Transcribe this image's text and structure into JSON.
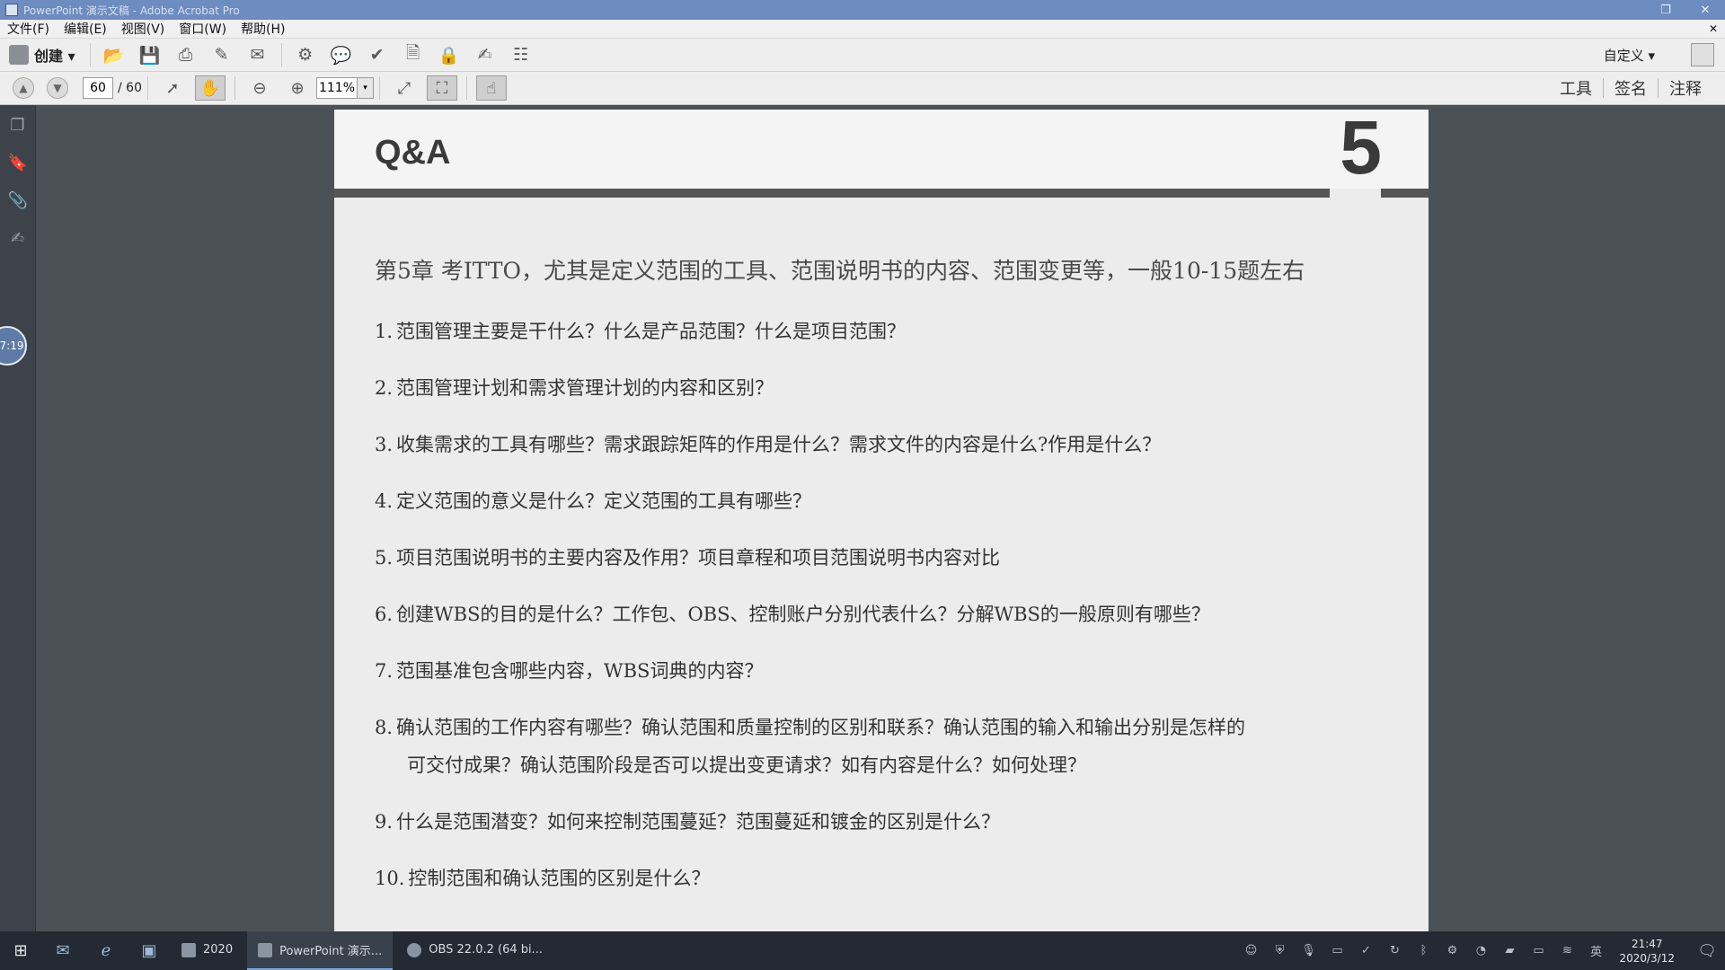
{
  "window": {
    "title": "PowerPoint 演示文稿 - Adobe Acrobat Pro",
    "restore_icon": "restore-icon",
    "close_icon": "close-icon",
    "restore_glyph": "❐",
    "close_glyph": "✕"
  },
  "menu": {
    "items": [
      "文件(F)",
      "编辑(E)",
      "视图(V)",
      "窗口(W)",
      "帮助(H)"
    ],
    "close_glyph": "✕"
  },
  "toolbar": {
    "create_label": "创建 ▾",
    "custom_label": "自定义 ▾"
  },
  "nav": {
    "current_page": "60",
    "total_pages": "/ 60",
    "zoom": "111%",
    "zoom_arrow": "▾",
    "tools_label": "工具",
    "sign_label": "签名",
    "comment_label": "注释"
  },
  "side": {
    "timer": "7:19"
  },
  "slide": {
    "title": "Q&A",
    "chapter": "5",
    "intro": "第5章  考ITTO，尤其是定义范围的工具、范围说明书的内容、范围变更等，一般10-15题左右",
    "questions": [
      {
        "num": "1.",
        "text": "范围管理主要是干什么？什么是产品范围？什么是项目范围？"
      },
      {
        "num": "2.",
        "text": "范围管理计划和需求管理计划的内容和区别？"
      },
      {
        "num": "3.",
        "text": "收集需求的工具有哪些？需求跟踪矩阵的作用是什么？需求文件的内容是什么?作用是什么？"
      },
      {
        "num": "4.",
        "text": "定义范围的意义是什么？定义范围的工具有哪些？"
      },
      {
        "num": "5.",
        "text": "项目范围说明书的主要内容及作用？项目章程和项目范围说明书内容对比"
      },
      {
        "num": "6.",
        "text": "创建WBS的目的是什么？工作包、OBS、控制账户分别代表什么？分解WBS的一般原则有哪些？"
      },
      {
        "num": "7.",
        "text": "范围基准包含哪些内容，WBS词典的内容？"
      },
      {
        "num": "8.",
        "text": "确认范围的工作内容有哪些？确认范围和质量控制的区别和联系？确认范围的输入和输出分别是怎样的",
        "cont": "可交付成果？确认范围阶段是否可以提出变更请求？如有内容是什么？如何处理？"
      },
      {
        "num": "9.",
        "text": "什么是范围潜变？如何来控制范围蔓延？范围蔓延和镀金的区别是什么？"
      },
      {
        "num": "10.",
        "text": "控制范围和确认范围的区别是什么？"
      }
    ]
  },
  "taskbar": {
    "folder_label": "2020",
    "ppt_label": "PowerPoint 演示...",
    "obs_label": "OBS 22.0.2 (64 bi...",
    "time": "21:47",
    "date": "2020/3/12",
    "ime": "英"
  }
}
